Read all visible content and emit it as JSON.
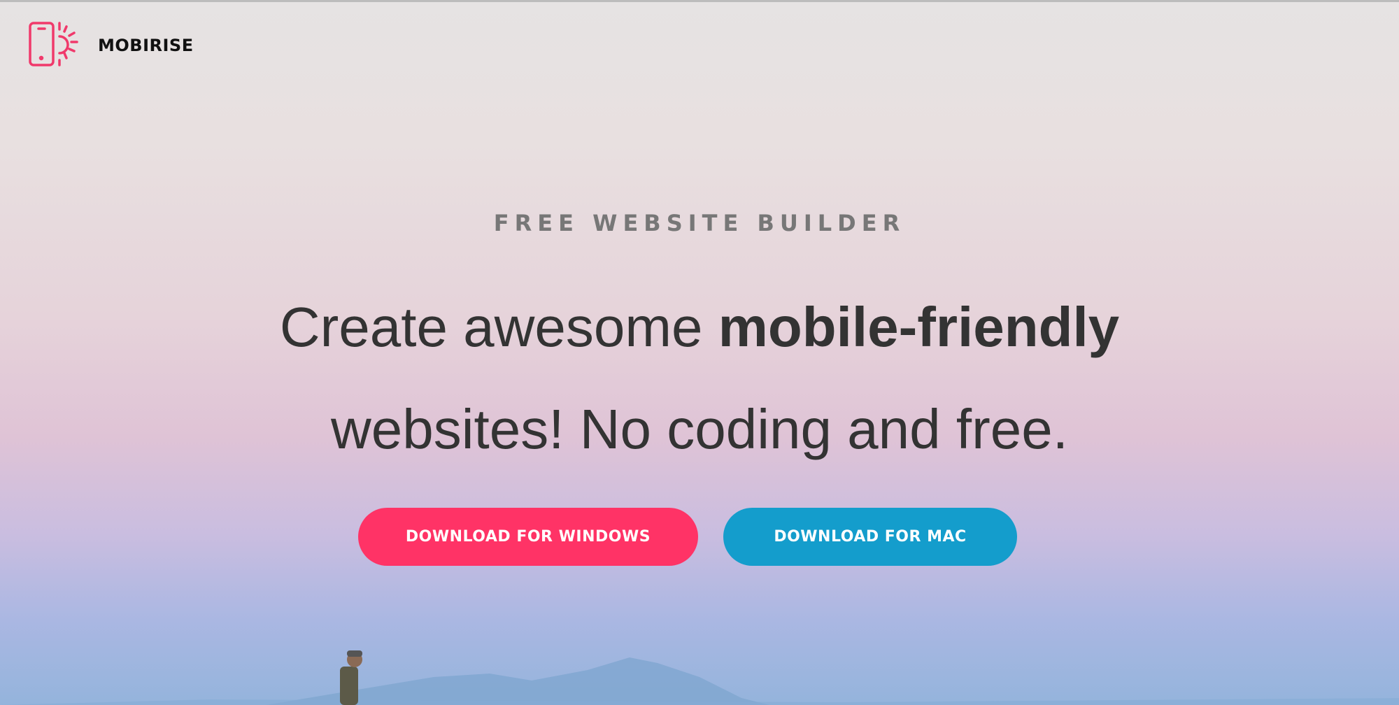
{
  "nav": {
    "brand_name": "MOBIRISE",
    "logo_icon": "phone-sun-icon",
    "logo_color": "#f0396b"
  },
  "hero": {
    "kicker": "FREE WEBSITE BUILDER",
    "headline_pre": "Create awesome ",
    "headline_bold": "mobile-friendly",
    "headline_line2": "websites! No coding and free.",
    "buttons": [
      {
        "label": "DOWNLOAD FOR WINDOWS",
        "color": "#ff3366"
      },
      {
        "label": "DOWNLOAD FOR MAC",
        "color": "#149dcc"
      }
    ]
  }
}
